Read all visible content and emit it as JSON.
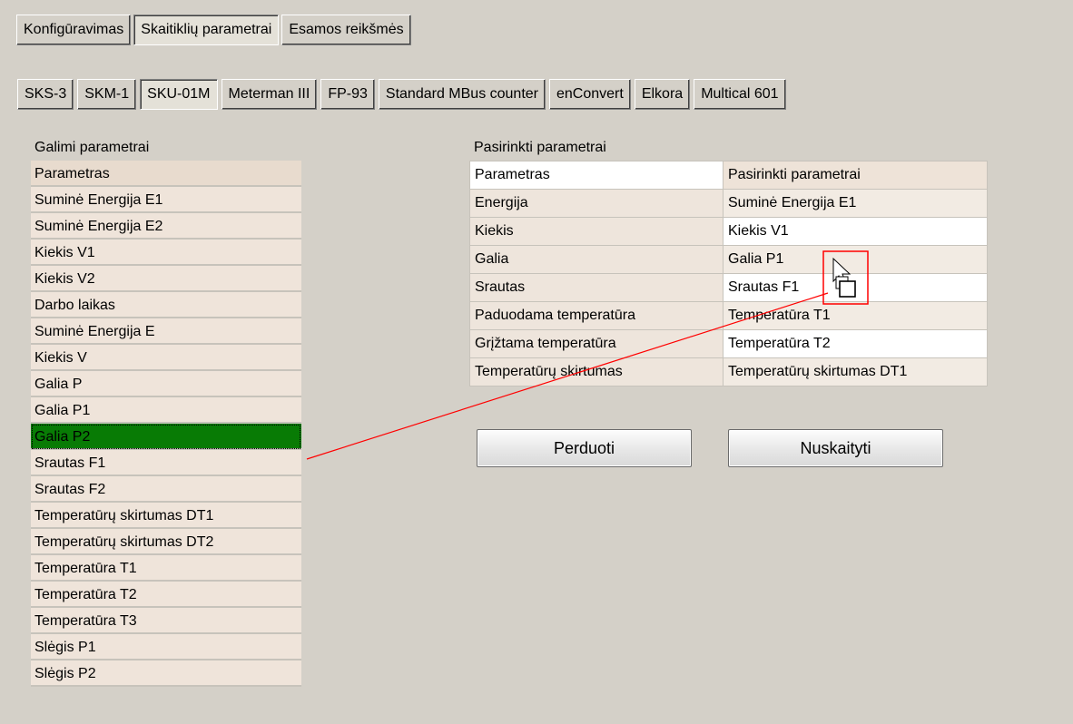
{
  "main_tabs": [
    {
      "label": "Konfigūravimas"
    },
    {
      "label": "Skaitiklių parametrai"
    },
    {
      "label": "Esamos reikšmės"
    }
  ],
  "meter_tabs": [
    {
      "label": "SKS-3"
    },
    {
      "label": "SKM-1"
    },
    {
      "label": "SKU-01M"
    },
    {
      "label": "Meterman III"
    },
    {
      "label": "FP-93"
    },
    {
      "label": "Standard MBus counter"
    },
    {
      "label": "enConvert"
    },
    {
      "label": "Elkora"
    },
    {
      "label": "Multical 601"
    }
  ],
  "available": {
    "title": "Galimi parametrai",
    "header": "Parametras",
    "items": [
      "Suminė Energija E1",
      "Suminė Energija E2",
      "Kiekis V1",
      "Kiekis V2",
      "Darbo laikas",
      "Suminė Energija E",
      "Kiekis V",
      "Galia P",
      "Galia P1",
      "Galia P2",
      "Srautas F1",
      "Srautas F2",
      "Temperatūrų skirtumas DT1",
      "Temperatūrų skirtumas DT2",
      "Temperatūra T1",
      "Temperatūra T2",
      "Temperatūra T3",
      "Slėgis P1",
      "Slėgis P2"
    ],
    "selected_item": "Galia P2"
  },
  "chosen": {
    "title": "Pasirinkti parametrai",
    "header_col1": "Parametras",
    "header_col2": "Pasirinkti parametrai",
    "rows": [
      {
        "param": "Energija",
        "value": "Suminė Energija E1"
      },
      {
        "param": "Kiekis",
        "value": "Kiekis V1"
      },
      {
        "param": "Galia",
        "value": "Galia P1"
      },
      {
        "param": "Srautas",
        "value": "Srautas F1"
      },
      {
        "param": "Paduodama temperatūra",
        "value": "Temperatūra T1"
      },
      {
        "param": "Grįžtama temperatūra",
        "value": "Temperatūra T2"
      },
      {
        "param": "Temperatūrų skirtumas",
        "value": "Temperatūrų skirtumas DT1"
      }
    ]
  },
  "buttons": {
    "transfer": "Perduoti",
    "read": "Nuskaityti"
  },
  "colors": {
    "selected_row": "#087b05",
    "drag_line": "#ff0000",
    "window_bg": "#d4d0c8"
  },
  "icons": [
    "arrow-cursor-icon",
    "drag-copy-icon"
  ]
}
